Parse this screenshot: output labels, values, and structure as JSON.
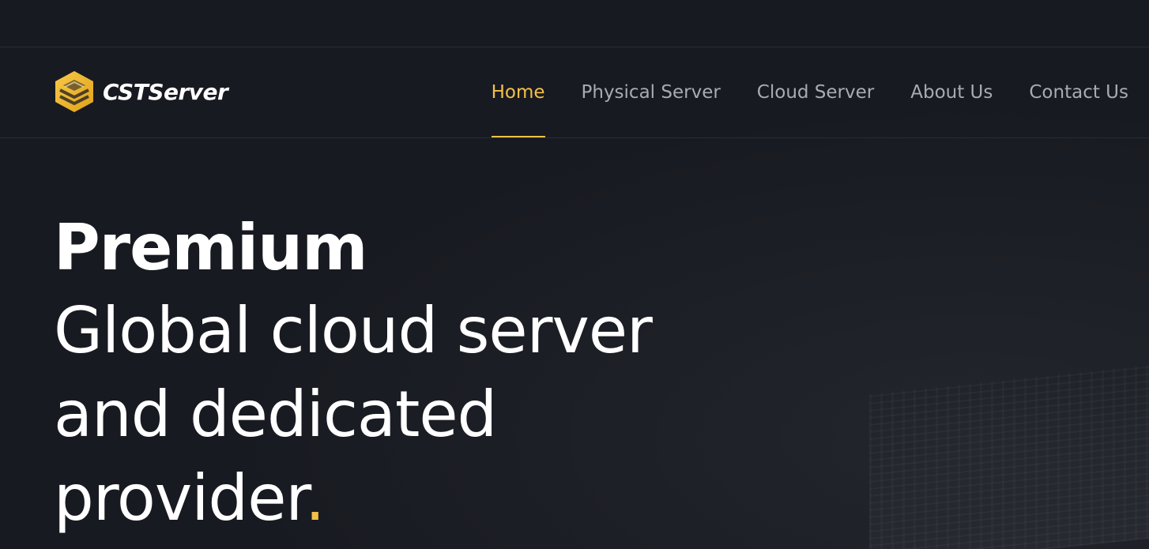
{
  "brand": {
    "name": "CSTServer",
    "logo_icon": "hexagon-layers-logo-icon",
    "accent_color": "#f2c14a"
  },
  "nav": {
    "items": [
      {
        "label": "Home",
        "active": true
      },
      {
        "label": "Physical Server",
        "active": false
      },
      {
        "label": "Cloud Server",
        "active": false
      },
      {
        "label": "About Us",
        "active": false
      },
      {
        "label": "Contact Us",
        "active": false
      }
    ]
  },
  "hero": {
    "headline_bold": "Premium",
    "headline_lines": [
      "Global cloud server",
      "and dedicated",
      "provider"
    ],
    "headline_end": "."
  },
  "colors": {
    "background": "#181a21",
    "text": "#ffffff",
    "nav_text": "#a9abb1",
    "accent": "#f2c14a"
  }
}
